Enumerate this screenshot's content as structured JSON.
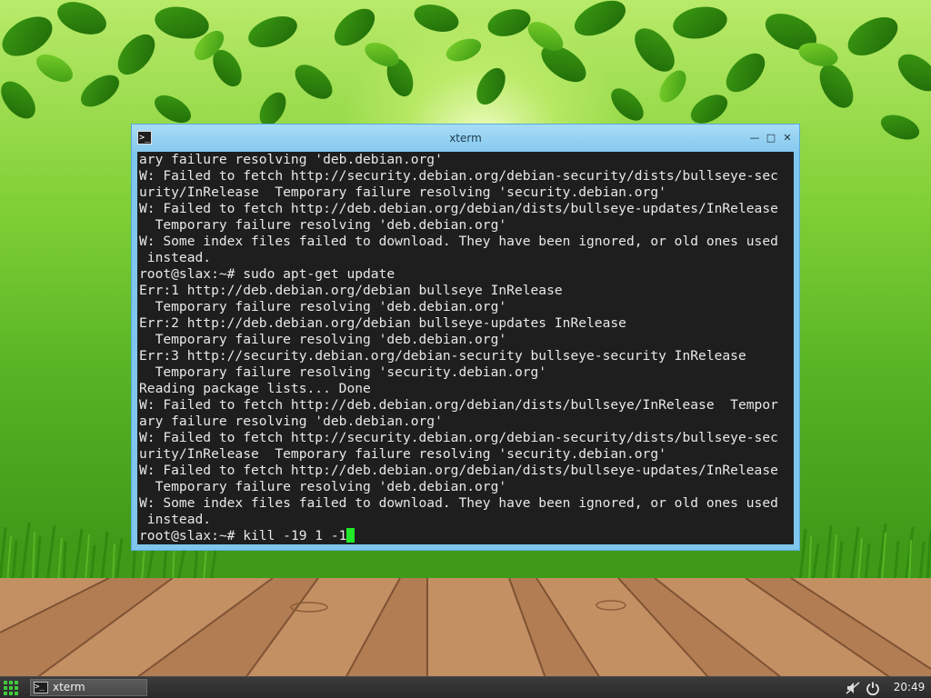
{
  "window": {
    "title": "xterm",
    "minimize_glyph": "—",
    "maximize_glyph": "□",
    "close_glyph": "✕"
  },
  "terminal": {
    "lines": [
      "ary failure resolving 'deb.debian.org'",
      "W: Failed to fetch http://security.debian.org/debian-security/dists/bullseye-sec",
      "urity/InRelease  Temporary failure resolving 'security.debian.org'",
      "W: Failed to fetch http://deb.debian.org/debian/dists/bullseye-updates/InRelease",
      "  Temporary failure resolving 'deb.debian.org'",
      "W: Some index files failed to download. They have been ignored, or old ones used",
      " instead.",
      "root@slax:~# sudo apt-get update",
      "Err:1 http://deb.debian.org/debian bullseye InRelease",
      "  Temporary failure resolving 'deb.debian.org'",
      "Err:2 http://deb.debian.org/debian bullseye-updates InRelease",
      "  Temporary failure resolving 'deb.debian.org'",
      "Err:3 http://security.debian.org/debian-security bullseye-security InRelease",
      "  Temporary failure resolving 'security.debian.org'",
      "Reading package lists... Done",
      "W: Failed to fetch http://deb.debian.org/debian/dists/bullseye/InRelease  Tempor",
      "ary failure resolving 'deb.debian.org'",
      "W: Failed to fetch http://security.debian.org/debian-security/dists/bullseye-sec",
      "urity/InRelease  Temporary failure resolving 'security.debian.org'",
      "W: Failed to fetch http://deb.debian.org/debian/dists/bullseye-updates/InRelease",
      "  Temporary failure resolving 'deb.debian.org'",
      "W: Some index files failed to download. They have been ignored, or old ones used",
      " instead."
    ],
    "prompt": "root@slax:~# ",
    "current_input": "kill -19 1 -1",
    "cursor_color": "#22e82a",
    "background_color": "#1e1e1e",
    "text_color": "#e8e8e8"
  },
  "taskbar": {
    "task_label": "xterm",
    "clock": "20:49",
    "start_icon": "grid-icon",
    "tray_icons": [
      "mute-icon",
      "power-icon"
    ]
  },
  "colors": {
    "window_frame": "#7fc6ee",
    "taskbar": "#2e2e2e",
    "start_accent": "#3ecb3e"
  }
}
